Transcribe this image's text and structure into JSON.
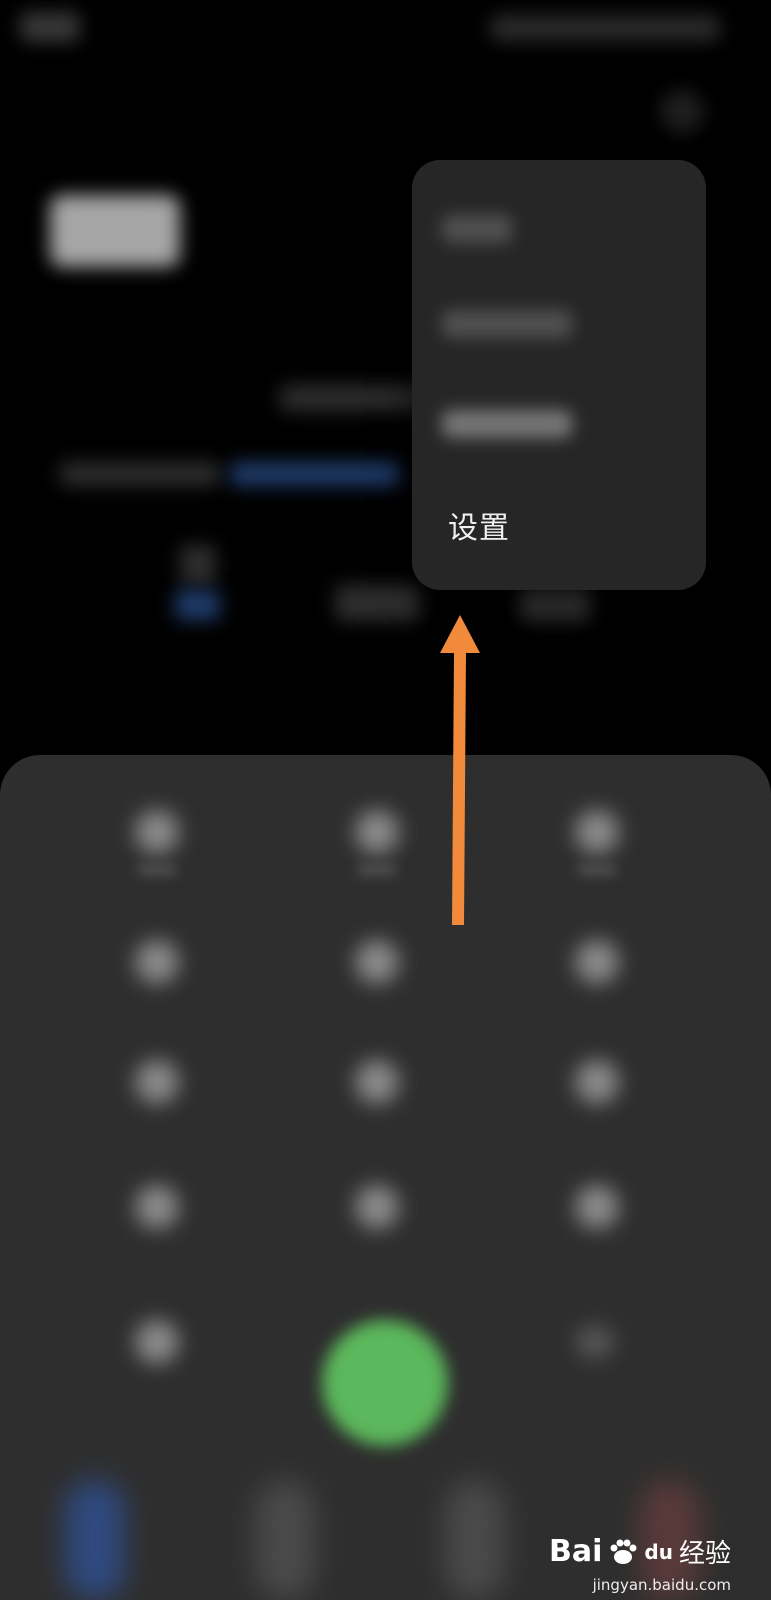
{
  "popup_menu": {
    "settings_label": "设置"
  },
  "watermark": {
    "logo_prefix": "Bai",
    "logo_mid": "du",
    "logo_suffix": "经验",
    "url": "jingyan.baidu.com"
  },
  "colors": {
    "background": "#000000",
    "popup": "#262626",
    "dialpad": "#2e2e2e",
    "call_button": "#5cb85c",
    "arrow": "#f28a3c"
  },
  "icons": {
    "annotation_arrow": "arrow-up-icon",
    "more": "more-vertical-icon",
    "paw": "baidu-paw-icon"
  }
}
